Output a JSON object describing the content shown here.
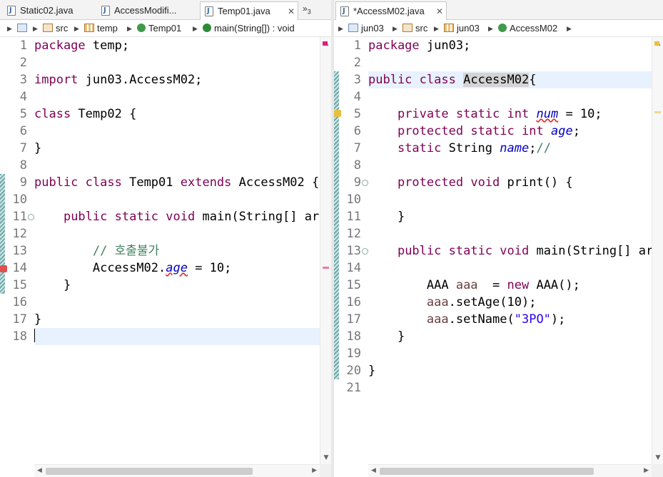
{
  "left": {
    "tabs": [
      {
        "label": "Static02.java"
      },
      {
        "label": "AccessModifi..."
      },
      {
        "label": "Temp01.java",
        "close": "✕"
      }
    ],
    "overflow": {
      "label": "»",
      "count": "3"
    },
    "breadcrumb": [
      {
        "label": "",
        "icon": "project-icon"
      },
      {
        "label": "src",
        "icon": "source-folder-icon"
      },
      {
        "label": "temp",
        "icon": "package-icon"
      },
      {
        "label": "Temp01",
        "icon": "class-icon"
      },
      {
        "label": "main(String[]) : void",
        "icon": "method-icon"
      }
    ],
    "lines": [
      {
        "n": "1",
        "parts": [
          {
            "t": "package",
            "c": "kw"
          },
          {
            "t": " temp;"
          }
        ]
      },
      {
        "n": "2",
        "parts": []
      },
      {
        "n": "3",
        "parts": [
          {
            "t": "import",
            "c": "kw"
          },
          {
            "t": " jun03.AccessM02;"
          }
        ]
      },
      {
        "n": "4",
        "parts": []
      },
      {
        "n": "5",
        "parts": [
          {
            "t": "class",
            "c": "kw"
          },
          {
            "t": " Temp02 {"
          }
        ]
      },
      {
        "n": "6",
        "parts": []
      },
      {
        "n": "7",
        "parts": [
          {
            "t": "}"
          }
        ]
      },
      {
        "n": "8",
        "parts": []
      },
      {
        "n": "9",
        "parts": [
          {
            "t": "public",
            "c": "kw"
          },
          {
            "t": " "
          },
          {
            "t": "class",
            "c": "kw"
          },
          {
            "t": " Temp01 "
          },
          {
            "t": "extends",
            "c": "kw"
          },
          {
            "t": " AccessM02 {"
          }
        ]
      },
      {
        "n": "10",
        "parts": []
      },
      {
        "n": "11",
        "fold": "⊖",
        "parts": [
          {
            "t": "    "
          },
          {
            "t": "public",
            "c": "kw"
          },
          {
            "t": " "
          },
          {
            "t": "static",
            "c": "kw"
          },
          {
            "t": " "
          },
          {
            "t": "void",
            "c": "kw"
          },
          {
            "t": " main(String[] args) {"
          }
        ]
      },
      {
        "n": "12",
        "parts": []
      },
      {
        "n": "13",
        "parts": [
          {
            "t": "        "
          },
          {
            "t": "// 호출불가",
            "c": "cm"
          }
        ]
      },
      {
        "n": "14",
        "parts": [
          {
            "t": "        AccessM02."
          },
          {
            "t": "age",
            "c": "fld squig"
          },
          {
            "t": " = 10;"
          }
        ]
      },
      {
        "n": "15",
        "parts": [
          {
            "t": "    }"
          }
        ]
      },
      {
        "n": "16",
        "parts": []
      },
      {
        "n": "17",
        "parts": [
          {
            "t": "}"
          }
        ]
      },
      {
        "n": "18",
        "parts": [],
        "caret": true,
        "hl": true
      }
    ]
  },
  "right": {
    "tabs": [
      {
        "label": "*AccessM02.java",
        "close": "✕"
      }
    ],
    "breadcrumb": [
      {
        "label": "jun03",
        "icon": "project-icon"
      },
      {
        "label": "src",
        "icon": "source-folder-icon"
      },
      {
        "label": "jun03",
        "icon": "package-icon"
      },
      {
        "label": "AccessM02",
        "icon": "class-icon"
      }
    ],
    "lines": [
      {
        "n": "1",
        "parts": [
          {
            "t": "package",
            "c": "kw"
          },
          {
            "t": " jun03;"
          }
        ]
      },
      {
        "n": "2",
        "parts": []
      },
      {
        "n": "3",
        "hl": true,
        "parts": [
          {
            "t": "public",
            "c": "kw"
          },
          {
            "t": " "
          },
          {
            "t": "class",
            "c": "kw"
          },
          {
            "t": " "
          },
          {
            "t": "AccessM02",
            "c": "ty-hl"
          },
          {
            "t": "{"
          }
        ]
      },
      {
        "n": "4",
        "parts": []
      },
      {
        "n": "5",
        "parts": [
          {
            "t": "    "
          },
          {
            "t": "private",
            "c": "kw"
          },
          {
            "t": " "
          },
          {
            "t": "static",
            "c": "kw"
          },
          {
            "t": " "
          },
          {
            "t": "int",
            "c": "kw"
          },
          {
            "t": " "
          },
          {
            "t": "num",
            "c": "fld squig"
          },
          {
            "t": " = 10;"
          }
        ]
      },
      {
        "n": "6",
        "parts": [
          {
            "t": "    "
          },
          {
            "t": "protected",
            "c": "kw"
          },
          {
            "t": " "
          },
          {
            "t": "static",
            "c": "kw"
          },
          {
            "t": " "
          },
          {
            "t": "int",
            "c": "kw"
          },
          {
            "t": " "
          },
          {
            "t": "age",
            "c": "fld"
          },
          {
            "t": ";"
          }
        ]
      },
      {
        "n": "7",
        "parts": [
          {
            "t": "    "
          },
          {
            "t": "static",
            "c": "kw"
          },
          {
            "t": " String "
          },
          {
            "t": "name",
            "c": "fld"
          },
          {
            "t": ";"
          },
          {
            "t": "//",
            "c": "cm"
          }
        ]
      },
      {
        "n": "8",
        "parts": []
      },
      {
        "n": "9",
        "fold": "⊖",
        "parts": [
          {
            "t": "    "
          },
          {
            "t": "protected",
            "c": "kw"
          },
          {
            "t": " "
          },
          {
            "t": "void",
            "c": "kw"
          },
          {
            "t": " print() {"
          }
        ]
      },
      {
        "n": "10",
        "parts": []
      },
      {
        "n": "11",
        "parts": [
          {
            "t": "    }"
          }
        ]
      },
      {
        "n": "12",
        "parts": []
      },
      {
        "n": "13",
        "fold": "⊖",
        "parts": [
          {
            "t": "    "
          },
          {
            "t": "public",
            "c": "kw"
          },
          {
            "t": " "
          },
          {
            "t": "static",
            "c": "kw"
          },
          {
            "t": " "
          },
          {
            "t": "void",
            "c": "kw"
          },
          {
            "t": " main(String[] args) {"
          }
        ]
      },
      {
        "n": "14",
        "parts": []
      },
      {
        "n": "15",
        "parts": [
          {
            "t": "        AAA "
          },
          {
            "t": "aaa",
            "c": "var"
          },
          {
            "t": "  = "
          },
          {
            "t": "new",
            "c": "kw"
          },
          {
            "t": " AAA();"
          }
        ]
      },
      {
        "n": "16",
        "parts": [
          {
            "t": "        "
          },
          {
            "t": "aaa",
            "c": "var"
          },
          {
            "t": ".setAge(10);"
          }
        ]
      },
      {
        "n": "17",
        "parts": [
          {
            "t": "        "
          },
          {
            "t": "aaa",
            "c": "var"
          },
          {
            "t": ".setName("
          },
          {
            "t": "\"3PO\"",
            "c": "str"
          },
          {
            "t": ");"
          }
        ]
      },
      {
        "n": "18",
        "parts": [
          {
            "t": "    }"
          }
        ]
      },
      {
        "n": "19",
        "parts": []
      },
      {
        "n": "20",
        "parts": [
          {
            "t": "}"
          }
        ]
      },
      {
        "n": "21",
        "parts": []
      }
    ]
  },
  "colors": {
    "keyword": "#7f0055",
    "field": "#0000c0",
    "comment": "#3f7f5f",
    "string": "#2a00ff",
    "variable": "#6a3e3e",
    "current_line": "#e8f2fe"
  },
  "scroll": {
    "up": "▲",
    "down": "▼",
    "left": "◀",
    "right": "▶"
  }
}
